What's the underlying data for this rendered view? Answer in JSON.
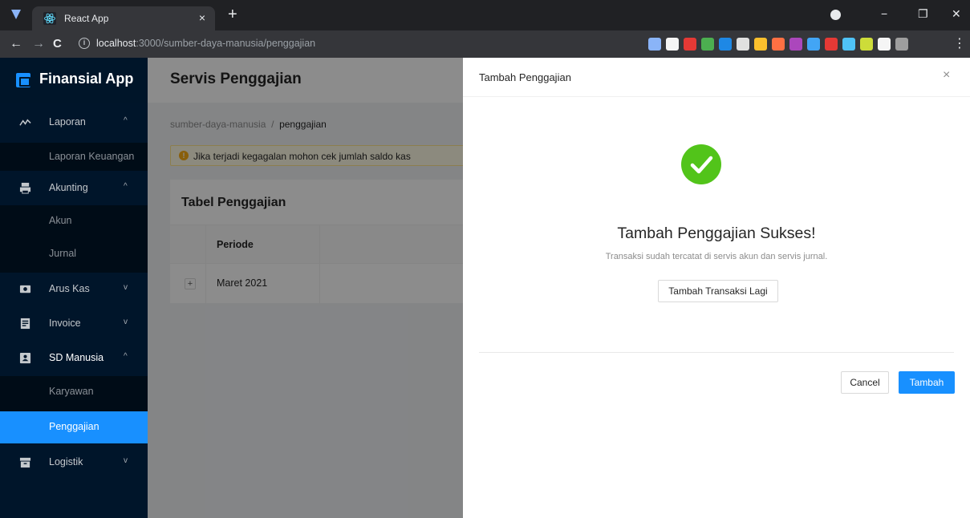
{
  "browser": {
    "tab_title": "React App",
    "tab_close": "×",
    "new_tab": "+",
    "url_host": "localhost",
    "url_path": ":3000/sumber-daya-manusia/penggajian",
    "window_controls": [
      "−",
      "❐",
      "✕"
    ],
    "nav": {
      "back": "←",
      "forward": "→",
      "reload": "C"
    },
    "extension_colors": [
      "#8ab4f8",
      "#f5f5f5",
      "#e53935",
      "#4caf50",
      "#1e88e5",
      "#e0e0e0",
      "#fbc02d",
      "#ff7043",
      "#ab47bc",
      "#42a5f5",
      "#e53935",
      "#4fc3f7",
      "#cddc39",
      "#f5f5f5",
      "#9e9e9e"
    ]
  },
  "sidebar": {
    "brand": "Finansial App",
    "menu": [
      {
        "label": "Laporan",
        "icon": "chart-line-icon",
        "arrow": "^",
        "children": [
          "Laporan Keuangan"
        ]
      },
      {
        "label": "Akunting",
        "icon": "printer-icon",
        "arrow": "^",
        "children": [
          "Akun",
          "Jurnal"
        ]
      },
      {
        "label": "Arus Kas",
        "icon": "money-icon",
        "arrow": "v"
      },
      {
        "label": "Invoice",
        "icon": "invoice-icon",
        "arrow": "v"
      },
      {
        "label": "SD Manusia",
        "icon": "id-card-icon",
        "arrow": "^",
        "children": [
          "Karyawan",
          "Penggajian"
        ]
      },
      {
        "label": "Logistik",
        "icon": "box-icon",
        "arrow": "v"
      }
    ],
    "active_item": "Penggajian"
  },
  "main": {
    "page_title": "Servis Penggajian",
    "breadcrumb": [
      "sumber-daya-manusia",
      "/",
      "penggajian"
    ],
    "alert_text": "Jika terjadi kegagalan mohon cek jumlah saldo kas",
    "table": {
      "title": "Tabel Penggajian",
      "columns": [
        "Periode"
      ],
      "rows": [
        {
          "periode": "Maret 2021",
          "expand": "+"
        }
      ]
    }
  },
  "drawer": {
    "title": "Tambah Penggajian",
    "close": "×",
    "result_title": "Tambah Penggajian Sukses!",
    "result_subtitle": "Transaksi sudah tercatat di servis akun dan servis jurnal.",
    "again_button": "Tambah Transaksi Lagi",
    "cancel_button": "Cancel",
    "submit_button": "Tambah"
  },
  "colors": {
    "primary": "#1890ff",
    "success": "#52c41a",
    "sidebar": "#001529",
    "warning": "#faad14"
  }
}
